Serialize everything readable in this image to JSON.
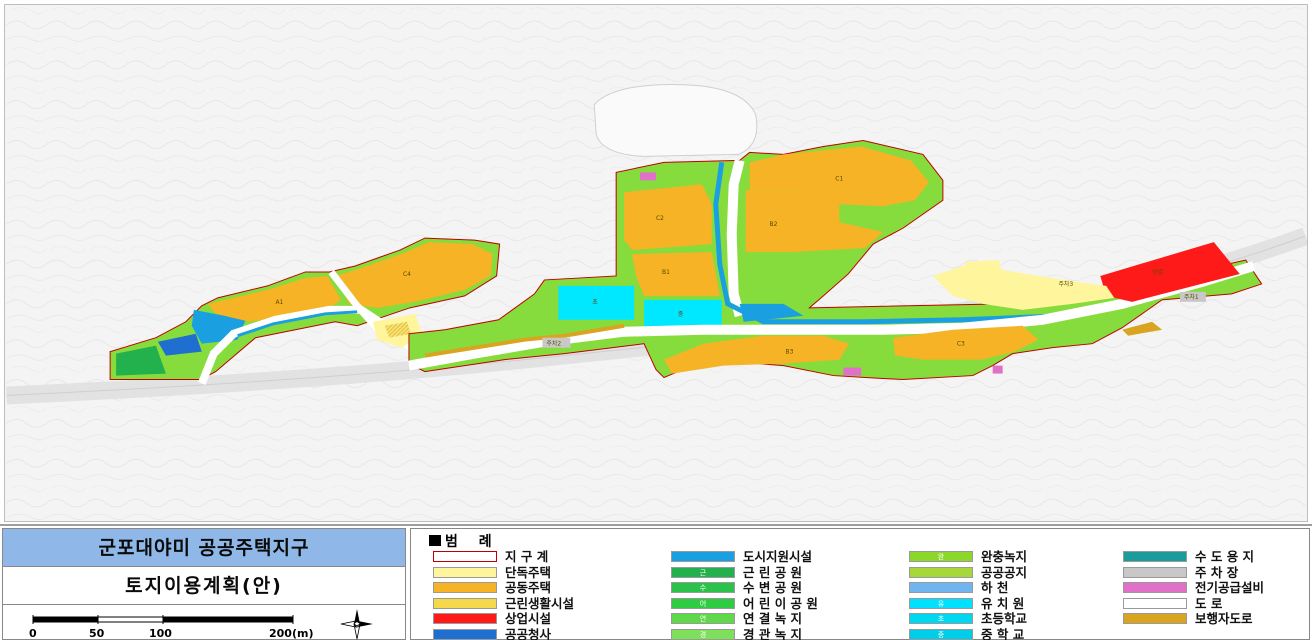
{
  "title_block": {
    "district_name": "군포대야미 공공주택지구",
    "plan_title": "토지이용계획(안)",
    "scale_labels": [
      "0",
      "50",
      "100",
      "200(m)"
    ]
  },
  "legend": {
    "heading": "범 례",
    "columns": [
      [
        {
          "label": "지 구 계",
          "color": "#ffffff",
          "border": "#c00000",
          "mark": ""
        },
        {
          "label": "단독주택",
          "color": "#fff59d",
          "mark": ""
        },
        {
          "label": "공동주택",
          "color": "#f5b325",
          "mark": ""
        },
        {
          "label": "근린생활시설",
          "color": "#f6d94a",
          "mark": ""
        },
        {
          "label": "상업시설",
          "color": "#ff1a1a",
          "mark": ""
        },
        {
          "label": "공공청사",
          "color": "#1f6fd1",
          "mark": ""
        }
      ],
      [
        {
          "label": "도시지원시설",
          "color": "#1aa0e0",
          "mark": ""
        },
        {
          "label": "근 린 공 원",
          "color": "#22b14c",
          "mark": "근"
        },
        {
          "label": "수 변 공 원",
          "color": "#2bc24a",
          "mark": "수"
        },
        {
          "label": "어 린 이 공 원",
          "color": "#2ecc40",
          "mark": "어"
        },
        {
          "label": "연 결 녹 지",
          "color": "#5fd84a",
          "mark": "연"
        },
        {
          "label": "경 관 녹 지",
          "color": "#7ee05a",
          "mark": "경"
        }
      ],
      [
        {
          "label": "완충녹지",
          "color": "#8bd82a",
          "mark": "완"
        },
        {
          "label": "공공공지",
          "color": "#a7d83a",
          "mark": ""
        },
        {
          "label": "하 천",
          "color": "#6fb6f0",
          "mark": ""
        },
        {
          "label": "유 치 원",
          "color": "#00e0ff",
          "mark": "유"
        },
        {
          "label": "초등학교",
          "color": "#00d8f0",
          "mark": "초"
        },
        {
          "label": "중 학 교",
          "color": "#00cde8",
          "mark": "중"
        }
      ],
      [
        {
          "label": "수 도 용 지",
          "color": "#1a9c9c",
          "mark": ""
        },
        {
          "label": "주 차 장",
          "color": "#c8c8c8",
          "mark": ""
        },
        {
          "label": "전기공급설비",
          "color": "#e070c8",
          "mark": ""
        },
        {
          "label": "도 로",
          "color": "#ffffff",
          "mark": ""
        },
        {
          "label": "보행자도로",
          "color": "#d9a520",
          "mark": ""
        }
      ]
    ]
  },
  "map": {
    "parcel_labels": [
      "A1",
      "C4",
      "C2",
      "B1",
      "B2",
      "C1",
      "B3",
      "C3",
      "초",
      "중",
      "상업",
      "주차1",
      "주차2",
      "주차3"
    ]
  },
  "colors": {
    "boundary": "#c00000",
    "apartment": "#f5b325",
    "park": "#22b14c",
    "road": "#ffffff",
    "stream": "#1aa0e0"
  }
}
